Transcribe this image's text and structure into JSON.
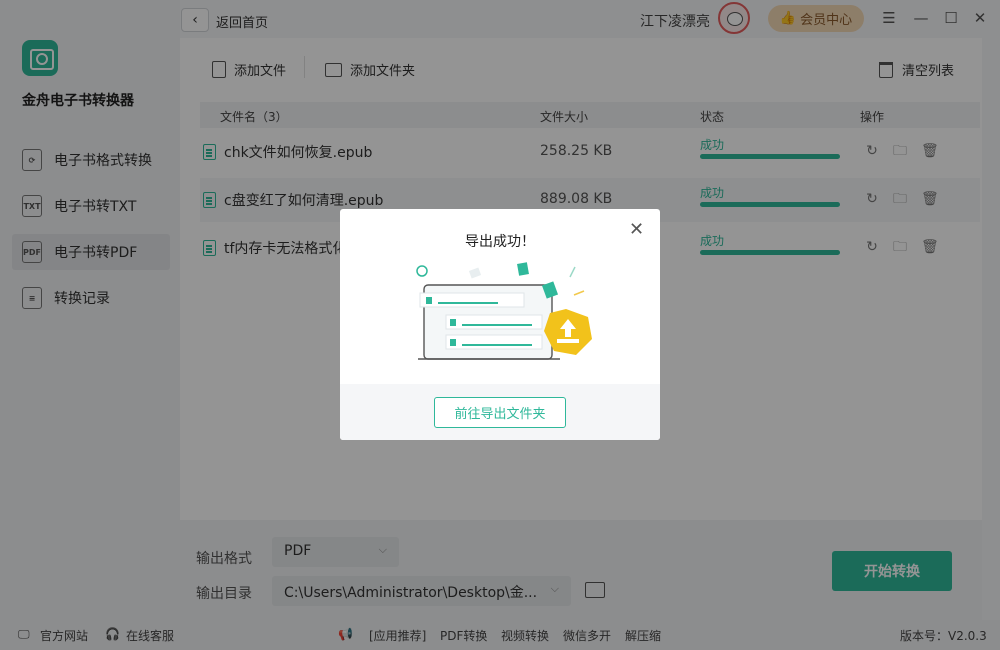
{
  "app": {
    "name": "金舟电子书转换器"
  },
  "nav": [
    {
      "label": "电子书格式转换",
      "icon": "refresh-book-icon",
      "tag": ""
    },
    {
      "label": "电子书转TXT",
      "icon": "txt-file-icon",
      "tag": "TXT"
    },
    {
      "label": "电子书转PDF",
      "icon": "pdf-file-icon",
      "tag": "PDF"
    },
    {
      "label": "转换记录",
      "icon": "history-icon",
      "tag": ""
    }
  ],
  "topbar": {
    "back_label": "返回首页",
    "username": "江下凌漂亮",
    "vip_label": "会员中心"
  },
  "toolbar": {
    "add_file": "添加文件",
    "add_folder": "添加文件夹",
    "clear_list": "清空列表"
  },
  "table": {
    "headers": {
      "name": "文件名（3）",
      "size": "文件大小",
      "status": "状态",
      "actions": "操作"
    },
    "rows": [
      {
        "name": "chk文件如何恢复.epub",
        "size": "258.25 KB",
        "status": "成功",
        "progress": 1.0
      },
      {
        "name": "c盘变红了如何清理.epub",
        "size": "889.08 KB",
        "status": "成功",
        "progress": 1.0
      },
      {
        "name": "tf内存卡无法格式化",
        "size": "",
        "status": "成功",
        "progress": 1.0
      }
    ]
  },
  "output": {
    "format_label": "输出格式",
    "format_value": "PDF",
    "dir_label": "输出目录",
    "dir_value": "C:\\Users\\Administrator\\Desktop\\金...",
    "start_button": "开始转换"
  },
  "statusbar": {
    "website": "官方网站",
    "support": "在线客服",
    "recommend": "[应用推荐]",
    "links": [
      "PDF转换",
      "视频转换",
      "微信多开",
      "解压缩"
    ],
    "version": "版本号：V2.0.3"
  },
  "dialog": {
    "title": "导出成功！",
    "button": "前往导出文件夹"
  },
  "colors": {
    "accent": "#2fb89a",
    "vip_bg": "#f3d9b6",
    "vip_text": "#8a5a2b"
  }
}
